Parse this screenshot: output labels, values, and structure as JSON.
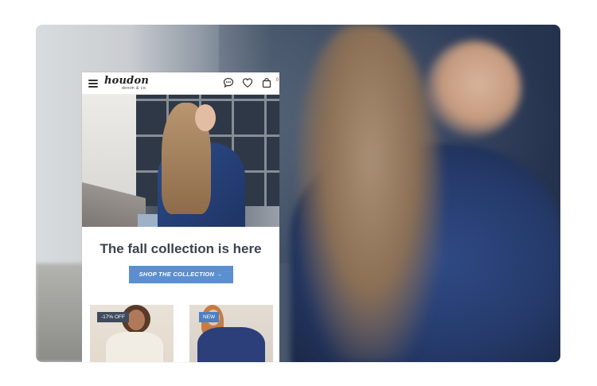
{
  "brand": {
    "name": "houdon",
    "tagline": "denim & co."
  },
  "header": {
    "cart_count": "0"
  },
  "hero": {
    "headline": "The fall collection is here",
    "cta_label": "SHOP THE COLLECTION →"
  },
  "products": [
    {
      "badge": "-17% OFF"
    },
    {
      "badge": "NEW"
    }
  ],
  "colors": {
    "accent": "#5b8fd1",
    "headline": "#3d4350",
    "badge_sale": "#3f4b5c",
    "badge_new": "#4f7fbf"
  }
}
